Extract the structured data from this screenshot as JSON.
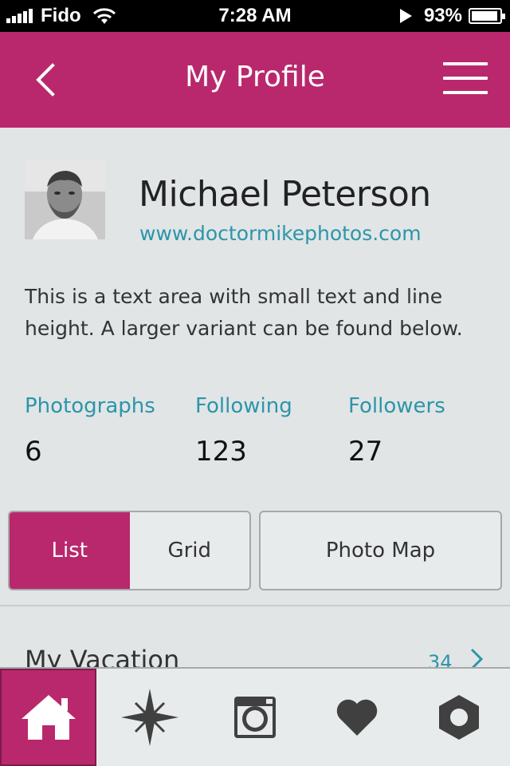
{
  "status_bar": {
    "carrier": "Fido",
    "time": "7:28 AM",
    "battery_percent": "93%",
    "battery_level": 0.93
  },
  "nav": {
    "title": "My Profile"
  },
  "profile": {
    "name": "Michael Peterson",
    "url": "www.doctormikephotos.com",
    "bio": "This is a text area with small text and line height. A larger variant can be found below."
  },
  "stats": [
    {
      "label": "Photographs",
      "value": "6"
    },
    {
      "label": "Following",
      "value": "123"
    },
    {
      "label": "Followers",
      "value": "27"
    }
  ],
  "view_switch": {
    "list_label": "List",
    "grid_label": "Grid",
    "photo_map_label": "Photo Map",
    "selected": "List"
  },
  "album": {
    "title": "My Vacation",
    "count": "34"
  },
  "tab_bar": {
    "items": [
      "home-icon",
      "compass-icon",
      "camera-icon",
      "heart-icon",
      "settings-icon"
    ],
    "active": "home-icon"
  },
  "colors": {
    "accent": "#b9286c",
    "link": "#2d95a9",
    "background": "#e1e5e6"
  }
}
